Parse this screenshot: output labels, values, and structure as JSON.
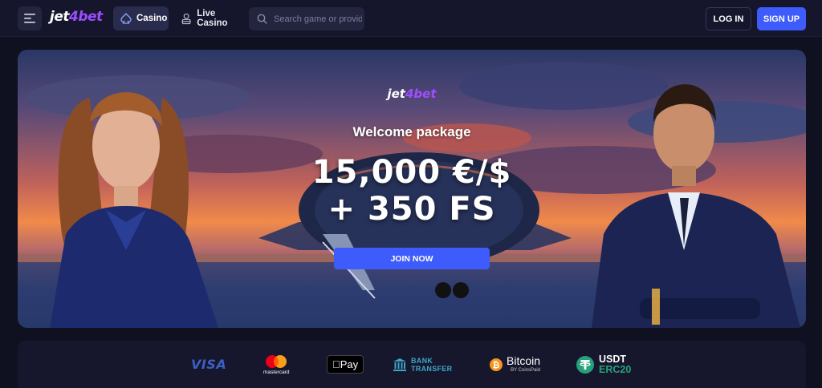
{
  "header": {
    "logo": {
      "part1": "jet",
      "part2": "4bet"
    },
    "nav": [
      {
        "label": "Casino",
        "active": true,
        "icon": "spade-icon"
      },
      {
        "label": "Live Casino",
        "active": false,
        "icon": "dealer-icon"
      }
    ],
    "search": {
      "placeholder": "Search game or provider",
      "value": ""
    },
    "login_label": "LOG IN",
    "signup_label": "SIGN UP"
  },
  "banner": {
    "logo": {
      "part1": "jet",
      "part2": "4bet"
    },
    "subtitle": "Welcome package",
    "headline_line1": "15,000 €/$",
    "headline_line2": "+ 350 FS",
    "cta_label": "JOIN NOW"
  },
  "payments": {
    "visa": "VISA",
    "mastercard": "mastercard",
    "apple_pay": "Pay",
    "bank_line1": "BANK",
    "bank_line2": "TRANSFER",
    "bitcoin": "Bitcoin",
    "bitcoin_sub": "BY CoinsPaid",
    "usdt_line1": "USDT",
    "usdt_line2": "ERC20"
  },
  "colors": {
    "background": "#0f1020",
    "header": "#15162b",
    "accent_blue": "#3e5bfb",
    "logo_purple": "#9b4dff",
    "active_tab": "#2a2c4e"
  }
}
